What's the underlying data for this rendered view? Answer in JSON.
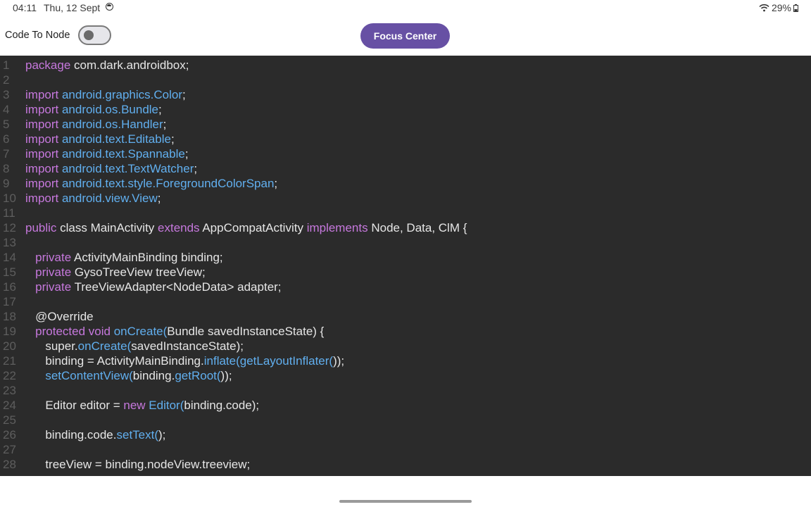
{
  "status_bar": {
    "time": "04:11",
    "date": "Thu, 12 Sept",
    "battery": "29%"
  },
  "toolbar": {
    "toggle_label": "Code To Node",
    "toggle_on": false,
    "focus_button": "Focus Center"
  },
  "colors": {
    "accent": "#6750a4",
    "editor_bg": "#2b2b2b",
    "keyword": "#c678dd",
    "function": "#61afef",
    "text": "#e6e6e6",
    "line_number": "#5e5e5e"
  },
  "editor": {
    "lines": [
      {
        "n": "1",
        "tokens": [
          [
            "k",
            "package"
          ],
          [
            "t",
            " com.dark.androidbox;"
          ]
        ]
      },
      {
        "n": "2",
        "tokens": []
      },
      {
        "n": "3",
        "tokens": [
          [
            "k",
            "import"
          ],
          [
            "f",
            " android.graphics.Color"
          ],
          [
            "t",
            ";"
          ]
        ]
      },
      {
        "n": "4",
        "tokens": [
          [
            "k",
            "import"
          ],
          [
            "f",
            " android.os.Bundle"
          ],
          [
            "t",
            ";"
          ]
        ]
      },
      {
        "n": "5",
        "tokens": [
          [
            "k",
            "import"
          ],
          [
            "f",
            " android.os.Handler"
          ],
          [
            "t",
            ";"
          ]
        ]
      },
      {
        "n": "6",
        "tokens": [
          [
            "k",
            "import"
          ],
          [
            "f",
            " android.text.Editable"
          ],
          [
            "t",
            ";"
          ]
        ]
      },
      {
        "n": "7",
        "tokens": [
          [
            "k",
            "import"
          ],
          [
            "f",
            " android.text.Spannable"
          ],
          [
            "t",
            ";"
          ]
        ]
      },
      {
        "n": "8",
        "tokens": [
          [
            "k",
            "import"
          ],
          [
            "f",
            " android.text.TextWatcher"
          ],
          [
            "t",
            ";"
          ]
        ]
      },
      {
        "n": "9",
        "tokens": [
          [
            "k",
            "import"
          ],
          [
            "f",
            " android.text.style.ForegroundColorSpan"
          ],
          [
            "t",
            ";"
          ]
        ]
      },
      {
        "n": "10",
        "tokens": [
          [
            "k",
            "import"
          ],
          [
            "f",
            " android.view.View"
          ],
          [
            "t",
            ";"
          ]
        ]
      },
      {
        "n": "11",
        "tokens": []
      },
      {
        "n": "12",
        "tokens": [
          [
            "k",
            "public"
          ],
          [
            "t",
            " class MainActivity "
          ],
          [
            "k",
            "extends"
          ],
          [
            "t",
            " AppCompatActivity "
          ],
          [
            "k",
            "implements"
          ],
          [
            "t",
            " Node, Data, ClM {"
          ]
        ]
      },
      {
        "n": "13",
        "tokens": []
      },
      {
        "n": "14",
        "tokens": [
          [
            "k",
            "   private"
          ],
          [
            "t",
            " ActivityMainBinding binding;"
          ]
        ]
      },
      {
        "n": "15",
        "tokens": [
          [
            "k",
            "   private"
          ],
          [
            "t",
            " GysoTreeView treeView;"
          ]
        ]
      },
      {
        "n": "16",
        "tokens": [
          [
            "k",
            "   private"
          ],
          [
            "t",
            " TreeViewAdapter<NodeData> adapter;"
          ]
        ]
      },
      {
        "n": "17",
        "tokens": []
      },
      {
        "n": "18",
        "tokens": [
          [
            "t",
            "   @Override"
          ]
        ]
      },
      {
        "n": "19",
        "tokens": [
          [
            "k",
            "   protected void"
          ],
          [
            "f",
            " onCreate("
          ],
          [
            "t",
            "Bundle savedInstanceState) {"
          ]
        ]
      },
      {
        "n": "20",
        "tokens": [
          [
            "t",
            "      super."
          ],
          [
            "f",
            "onCreate("
          ],
          [
            "t",
            "savedInstanceState);"
          ]
        ]
      },
      {
        "n": "21",
        "tokens": [
          [
            "t",
            "      binding = ActivityMainBinding."
          ],
          [
            "f",
            "inflate(getLayoutInflater("
          ],
          [
            "t",
            "));"
          ]
        ]
      },
      {
        "n": "22",
        "tokens": [
          [
            "f",
            "      setContentView("
          ],
          [
            "t",
            "binding."
          ],
          [
            "f",
            "getRoot("
          ],
          [
            "t",
            "));"
          ]
        ]
      },
      {
        "n": "23",
        "tokens": []
      },
      {
        "n": "24",
        "tokens": [
          [
            "t",
            "      Editor editor = "
          ],
          [
            "k",
            "new"
          ],
          [
            "f",
            " Editor("
          ],
          [
            "t",
            "binding.code);"
          ]
        ]
      },
      {
        "n": "25",
        "tokens": []
      },
      {
        "n": "26",
        "tokens": [
          [
            "t",
            "      binding.code."
          ],
          [
            "f",
            "setText("
          ],
          [
            "t",
            ");"
          ]
        ]
      },
      {
        "n": "27",
        "tokens": []
      },
      {
        "n": "28",
        "tokens": [
          [
            "t",
            "      treeView = binding.nodeView.treeview;"
          ]
        ]
      }
    ]
  }
}
